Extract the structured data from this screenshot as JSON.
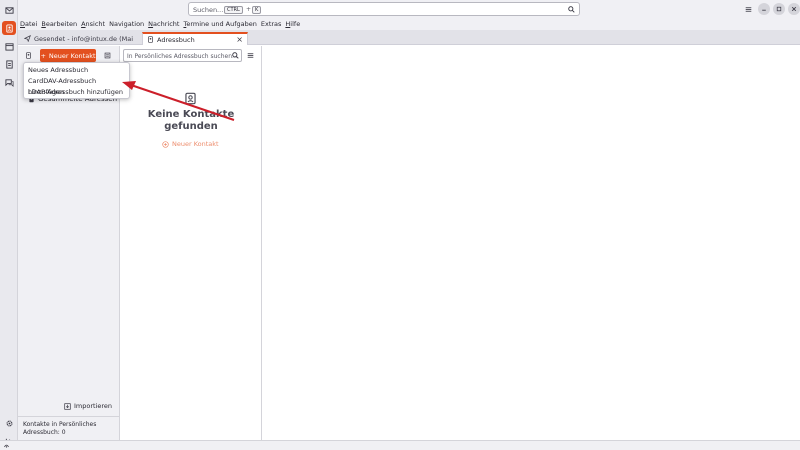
{
  "search": {
    "placeholder": "Suchen...",
    "shortcut_key1": "CTRL",
    "shortcut_plus": "+",
    "shortcut_key2": "K"
  },
  "menubar": {
    "items": [
      {
        "accel": "D",
        "rest": "atei"
      },
      {
        "accel": "B",
        "rest": "earbeiten"
      },
      {
        "accel": "A",
        "rest": "nsicht"
      },
      {
        "accel": "",
        "rest": "Navigation"
      },
      {
        "accel": "N",
        "rest": "achricht"
      },
      {
        "accel": "T",
        "rest": "ermine und Aufgaben"
      },
      {
        "accel": "",
        "rest": "Extras"
      },
      {
        "accel": "H",
        "rest": "ilfe"
      }
    ]
  },
  "tabs": [
    {
      "label": "Gesendet - info@intux.de (Mai"
    },
    {
      "label": "Adressbuch",
      "close": "×"
    }
  ],
  "books": {
    "new_contact_label": "Neuer Kontakt",
    "collected_label": "Gesammelte Adressen",
    "import_label": "Importieren",
    "footer_text": "Kontakte in Persönliches Adressbuch: 0"
  },
  "contacts": {
    "search_placeholder": "In Persönliches Adressbuch suchen...",
    "empty_title": "Keine Kontakte gefunden",
    "empty_new_label": "Neuer Kontakt"
  },
  "dropdown": {
    "items": [
      "Neues Adressbuch",
      "CardDAV-Adressbuch hinzufügen",
      "LDAP-Adressbuch hinzufügen"
    ]
  },
  "colors": {
    "accent": "#e3501f",
    "arrow": "#cc1f2a"
  }
}
